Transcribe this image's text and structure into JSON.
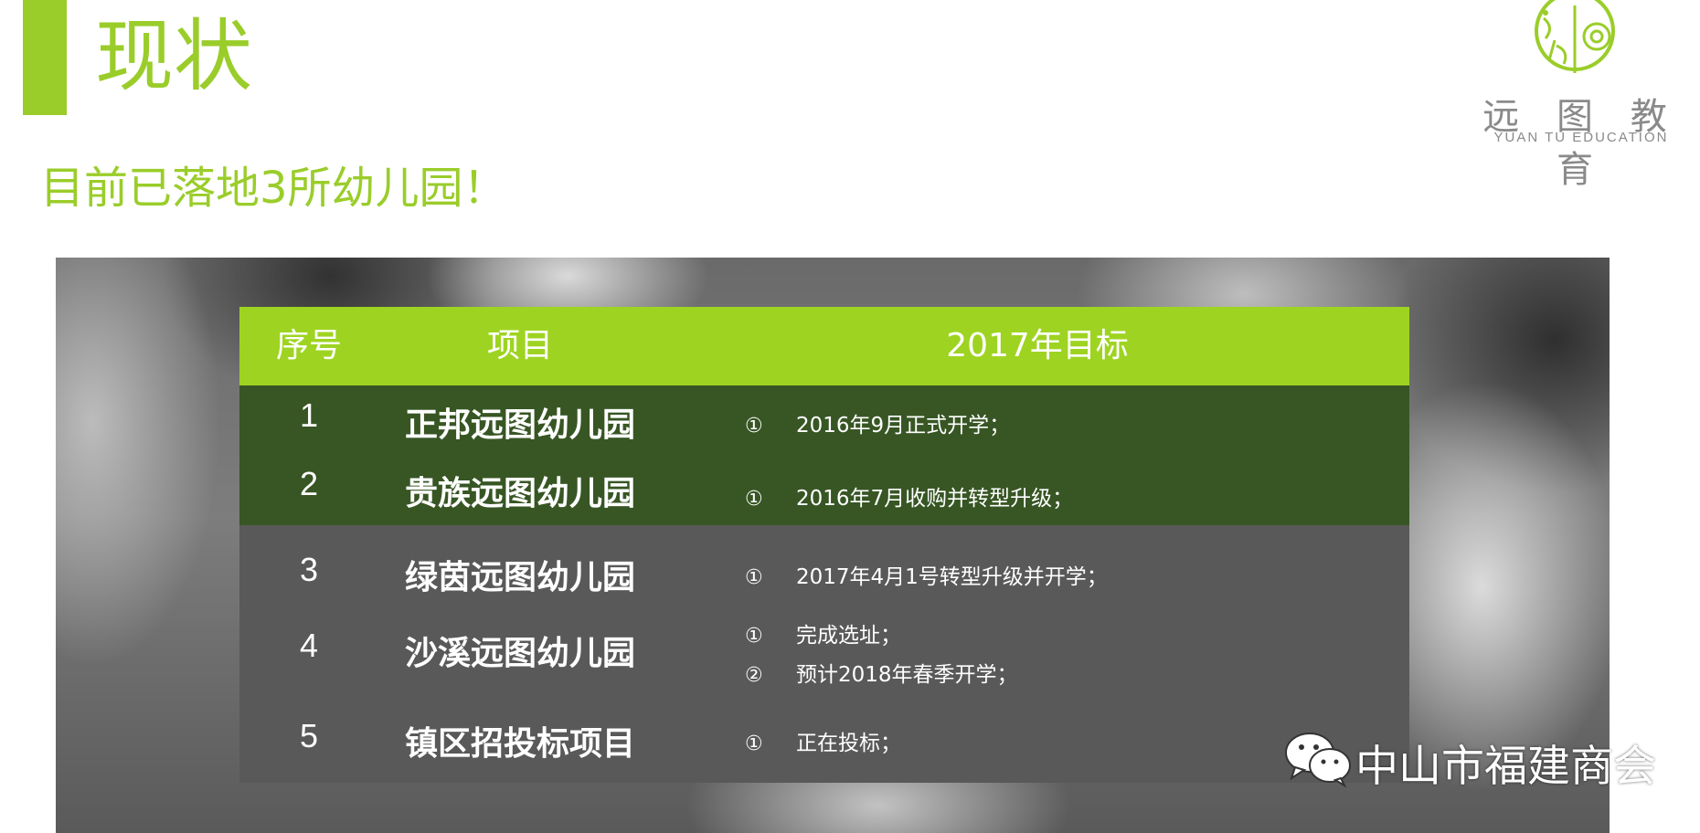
{
  "header": {
    "title": "现状",
    "subtitle": "目前已落地3所幼儿园！"
  },
  "logo": {
    "name_cn": "远 图 教 育",
    "name_en": "YUAN TU EDUCATION"
  },
  "table": {
    "columns": [
      "序号",
      "项目",
      "2017年目标"
    ],
    "rows": [
      {
        "no": "1",
        "project": "正邦远图幼儿园",
        "goals": [
          {
            "marker": "①",
            "text": "2016年9月正式开学；"
          }
        ]
      },
      {
        "no": "2",
        "project": "贵族远图幼儿园",
        "goals": [
          {
            "marker": "①",
            "text": "2016年7月收购并转型升级；"
          }
        ]
      },
      {
        "no": "3",
        "project": "绿茵远图幼儿园",
        "goals": [
          {
            "marker": "①",
            "text": "2017年4月1号转型升级并开学；"
          }
        ]
      },
      {
        "no": "4",
        "project": "沙溪远图幼儿园",
        "goals": [
          {
            "marker": "①",
            "text": "完成选址；"
          },
          {
            "marker": "②",
            "text": "预计2018年春季开学；"
          }
        ]
      },
      {
        "no": "5",
        "project": "镇区招投标项目",
        "goals": [
          {
            "marker": "①",
            "text": "正在投标；"
          }
        ]
      }
    ]
  },
  "watermark": {
    "icon": "wechat-icon",
    "text": "中山市福建商会"
  },
  "colors": {
    "accent": "#9acd2a",
    "header_row": "#9ed421",
    "dark_row": "#375624",
    "grey_row": "#595959"
  }
}
